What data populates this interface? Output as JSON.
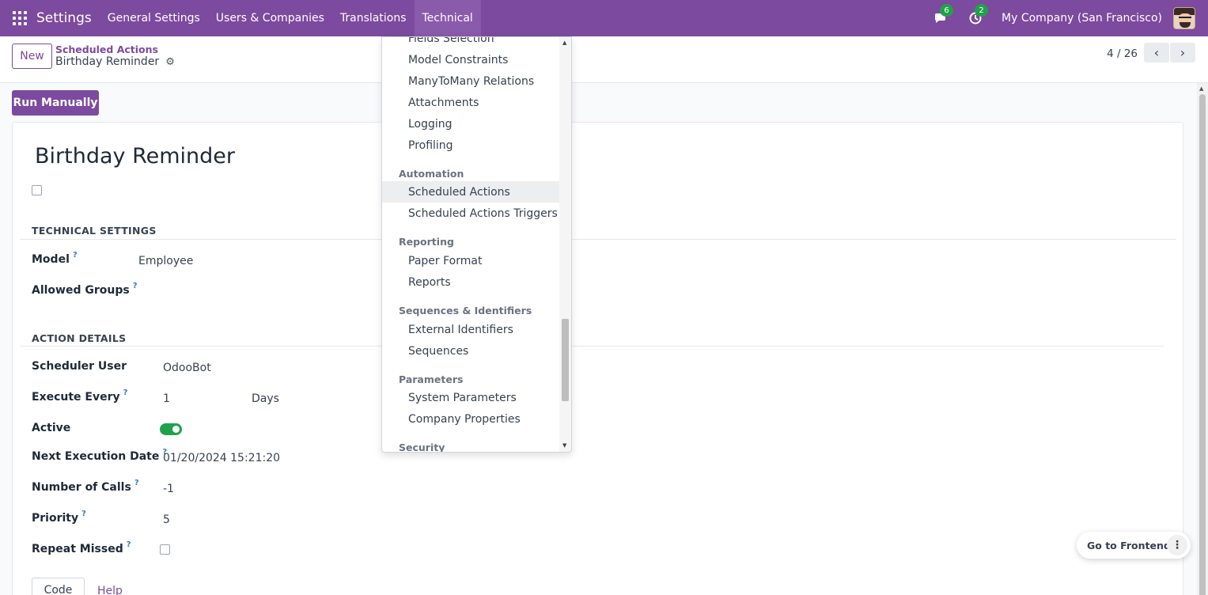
{
  "navbar": {
    "brand": "Settings",
    "menu": [
      "General Settings",
      "Users & Companies",
      "Translations",
      "Technical"
    ],
    "messages_count": "6",
    "activities_count": "2",
    "company": "My Company (San Francisco)"
  },
  "control_panel": {
    "new_label": "New",
    "breadcrumb_parent": "Scheduled Actions",
    "breadcrumb_current": "Birthday Reminder",
    "pager": "4 / 26"
  },
  "actions": {
    "run_manually": "Run Manually"
  },
  "form": {
    "title": "Birthday Reminder",
    "technical_settings": {
      "heading": "TECHNICAL SETTINGS",
      "model_label": "Model",
      "model_value": "Employee",
      "allowed_groups_label": "Allowed Groups",
      "allowed_groups_value": ""
    },
    "action_details": {
      "heading": "ACTION DETAILS",
      "scheduler_user_label": "Scheduler User",
      "scheduler_user_value": "OdooBot",
      "execute_every_label": "Execute Every",
      "execute_every_value": "1",
      "execute_every_unit": "Days",
      "active_label": "Active",
      "active": true,
      "next_execution_label": "Next Execution Date",
      "next_execution_value": "01/20/2024 15:21:20",
      "number_of_calls_label": "Number of Calls",
      "number_of_calls_value": "-1",
      "priority_label": "Priority",
      "priority_value": "5",
      "repeat_missed_label": "Repeat Missed",
      "repeat_missed": false
    },
    "tabs": {
      "code": "Code",
      "help": "Help"
    },
    "help_mark": "?"
  },
  "dropdown": {
    "cut_item": "Fields Selection",
    "items_top": [
      "Model Constraints",
      "ManyToMany Relations",
      "Attachments",
      "Logging",
      "Profiling"
    ],
    "sections": [
      {
        "header": "Automation",
        "items": [
          "Scheduled Actions",
          "Scheduled Actions Triggers"
        ]
      },
      {
        "header": "Reporting",
        "items": [
          "Paper Format",
          "Reports"
        ]
      },
      {
        "header": "Sequences & Identifiers",
        "items": [
          "External Identifiers",
          "Sequences"
        ]
      },
      {
        "header": "Parameters",
        "items": [
          "System Parameters",
          "Company Properties"
        ]
      },
      {
        "header": "Security",
        "items": []
      }
    ],
    "selected": "Scheduled Actions"
  },
  "frontend": {
    "label": "Go to Frontend"
  },
  "colors": {
    "brand": "#7c4a9e",
    "success": "#1fa24a",
    "help": "#2d7ec7"
  }
}
